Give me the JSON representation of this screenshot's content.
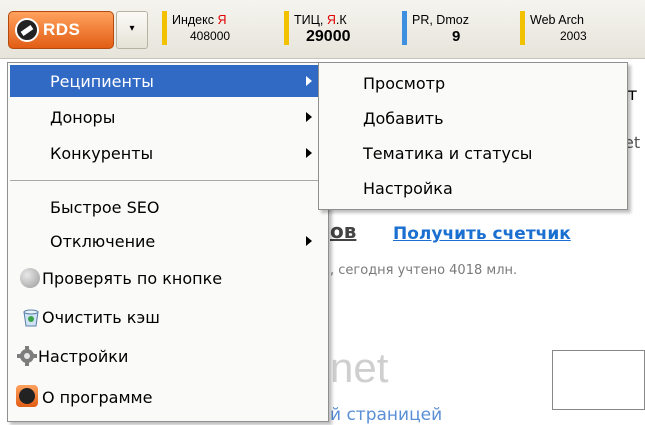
{
  "toolbar": {
    "rds_label": "RDS",
    "dropdown_glyph": "▾",
    "metrics": [
      {
        "line1_pre": "Индекс ",
        "line1_accent": "Я",
        "value": "408000",
        "bar_color": "#f2c200"
      },
      {
        "line1_pre": "ТИЦ, ",
        "line1_accent": "Я",
        "line1_post": ".К",
        "value": "29000",
        "bar_color": "#f2c200"
      },
      {
        "line1_pre": "PR, Dmoz",
        "value": "9",
        "bar_color": "#3d8fe0"
      },
      {
        "line1_pre": "Web Arch",
        "value": "2003",
        "bar_color": "#f2c200"
      }
    ]
  },
  "background": {
    "fragment_top": "ст",
    "fragment_right": "et",
    "heading_fragment": "ов",
    "link": "Получить счетчик",
    "counter_text": ", сегодня учтено 4018 млн.",
    "big_fragment": "net",
    "bottom_fragment": "й страницей"
  },
  "main_menu": {
    "items": [
      {
        "label": "Реципиенты",
        "submenu": true,
        "highlighted": true
      },
      {
        "label": "Доноры",
        "submenu": true
      },
      {
        "label": "Конкуренты",
        "submenu": true
      },
      {
        "label": "Быстрое SEO"
      },
      {
        "label": "Отключение",
        "submenu": true
      },
      {
        "label": "Проверять по кнопке",
        "icon": "gray-circle-icon"
      },
      {
        "label": "Очистить кэш",
        "icon": "clear-cache-icon"
      },
      {
        "label": "Настройки",
        "icon": "gear-icon"
      },
      {
        "label": "О программе",
        "icon": "rds-logo-icon"
      }
    ]
  },
  "sub_menu": {
    "items": [
      {
        "label": "Просмотр"
      },
      {
        "label": "Добавить"
      },
      {
        "label": "Тематика и статусы"
      },
      {
        "label": "Настройка"
      }
    ]
  },
  "colors": {
    "highlight": "#316ac5",
    "rds_orange": "#e25d14",
    "link_blue": "#1a6fd0"
  }
}
